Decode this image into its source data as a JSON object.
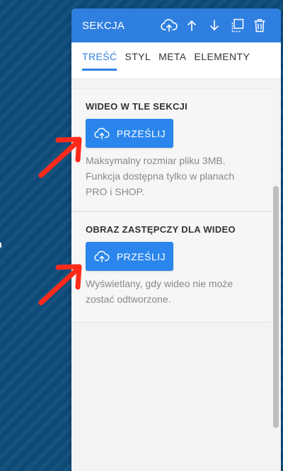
{
  "panel": {
    "title": "SEKCJA",
    "header_icons": [
      "cloud-upload-icon",
      "arrow-up-icon",
      "arrow-down-icon",
      "duplicate-icon",
      "trash-icon"
    ],
    "accent_color": "#2f7fe0"
  },
  "tabs": [
    {
      "label": "TREŚĆ",
      "active": true
    },
    {
      "label": "STYL",
      "active": false
    },
    {
      "label": "META",
      "active": false
    },
    {
      "label": "ELEMENTY",
      "active": false
    }
  ],
  "sections": [
    {
      "title": "WIDEO W TLE SEKCJI",
      "button_label": "PRZEŚLIJ",
      "hint_lines": [
        "Maksymalny rozmiar pliku 3MB.",
        "Funkcja dostępna tylko w planach",
        "PRO i SHOP."
      ]
    },
    {
      "title": "OBRAZ ZASTĘPCZY DLA WIDEO",
      "button_label": "PRZEŚLIJ",
      "hint_lines": [
        "Wyświetlany, gdy wideo nie może",
        "zostać odtworzone."
      ]
    }
  ],
  "annotation_color": "#ff2a1a"
}
